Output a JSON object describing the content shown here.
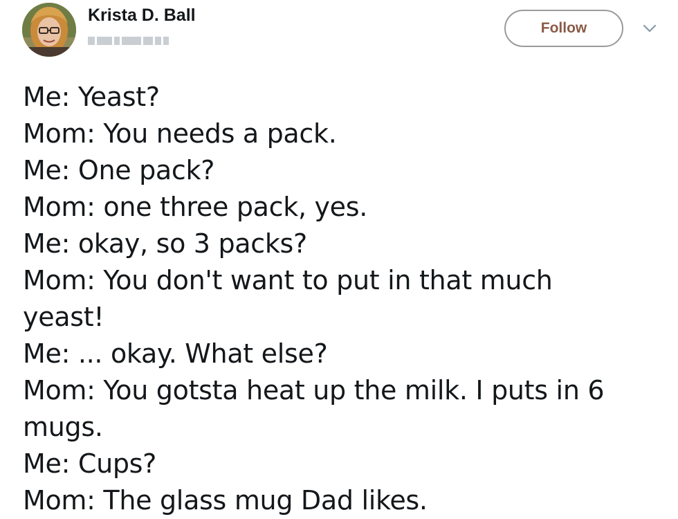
{
  "author": {
    "display_name": "Krista D. Ball",
    "avatar_icon": "profile-photo"
  },
  "actions": {
    "follow_label": "Follow",
    "more_icon": "chevron-down-icon"
  },
  "colors": {
    "follow_text": "#8a5a47",
    "follow_border": "#9a9a9a",
    "text": "#14171a"
  },
  "tweet": {
    "lines": [
      "Me: Yeast?",
      "Mom: You needs a pack.",
      "Me: One pack?",
      "Mom: one three pack, yes.",
      "Me: okay, so 3 packs?",
      "Mom: You don't want to put in that much",
      "yeast!",
      "Me: ... okay. What else?",
      "Mom: You gotsta heat up the milk. I puts in 6",
      "mugs.",
      "Me: Cups?",
      "Mom: The glass mug Dad likes."
    ]
  }
}
